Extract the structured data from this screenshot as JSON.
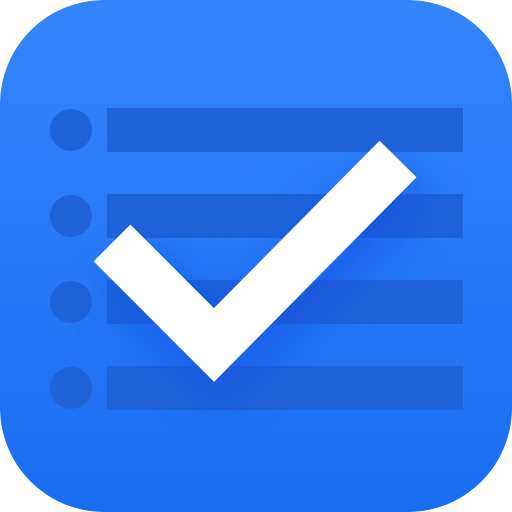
{
  "app_icon": {
    "name": "todo-checklist-app-icon",
    "colors": {
      "background_top": "#3485FB",
      "background_bottom": "#1A6DF0",
      "list_marks": "#1F63D8",
      "checkmark": "#FFFFFF",
      "checkmark_shadow": "#0A4FE0"
    },
    "list_rows": [
      {
        "icon": "bullet-dot"
      },
      {
        "icon": "bullet-dot"
      },
      {
        "icon": "bullet-dot"
      },
      {
        "icon": "bullet-dot"
      }
    ],
    "overlay_icon": "checkmark-icon"
  }
}
